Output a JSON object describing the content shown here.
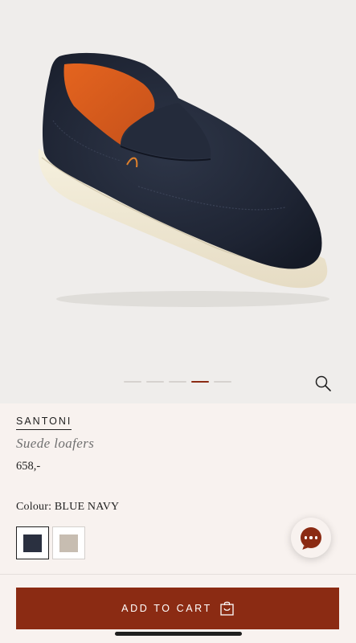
{
  "gallery": {
    "slide_count": 5,
    "active_slide_index": 4
  },
  "product": {
    "brand": "SANTONI",
    "title": "Suede loafers",
    "price": "658,-",
    "colour_label": "Colour: BLUE NAVY",
    "swatches": [
      {
        "name": "blue-navy",
        "color": "#2a3040",
        "selected": true
      },
      {
        "name": "beige",
        "color": "#c7bdb1",
        "selected": false
      }
    ]
  },
  "actions": {
    "add_to_cart_label": "ADD TO CART"
  },
  "colors": {
    "accent": "#8b2b13",
    "page_background": "#f8f2ef",
    "hero_background": "#efedeb"
  },
  "icons": {
    "zoom": "magnifier-icon",
    "cart": "shopping-bag-icon",
    "chat": "chat-bubble-icon"
  }
}
